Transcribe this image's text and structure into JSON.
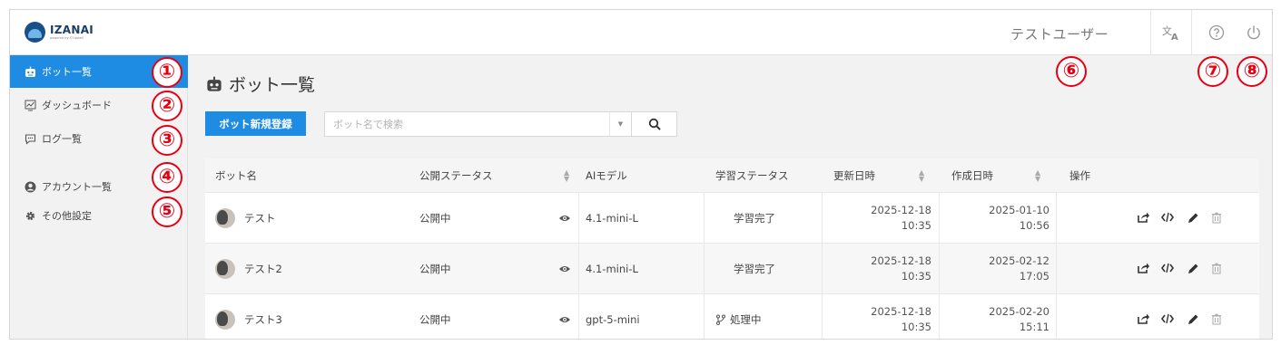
{
  "header": {
    "logo_name": "IZANAI",
    "logo_sub": "powered by ©Upwell",
    "user_name": "テストユーザー"
  },
  "sidebar": {
    "items": [
      {
        "label": "ボット一覧",
        "icon": "robot-icon",
        "active": true
      },
      {
        "label": "ダッシュボード",
        "icon": "chart-icon",
        "active": false
      },
      {
        "label": "ログ一覧",
        "icon": "chat-icon",
        "active": false
      },
      {
        "label": "アカウント一覧",
        "icon": "user-icon",
        "active": false
      },
      {
        "label": "その他設定",
        "icon": "gear-icon",
        "active": false
      }
    ]
  },
  "annotations": [
    "①",
    "②",
    "③",
    "④",
    "⑤",
    "⑥",
    "⑦",
    "⑧"
  ],
  "main": {
    "title": "ボット一覧",
    "new_button": "ボット新規登録",
    "search_placeholder": "ボット名で検索",
    "columns": [
      "ボット名",
      "公開ステータス",
      "AIモデル",
      "学習ステータス",
      "更新日時",
      "作成日時",
      "操作"
    ],
    "rows": [
      {
        "name": "テスト",
        "publish": "公開中",
        "model": "4.1-mini-L",
        "learn": "学習完了",
        "updated_date": "2025-12-18",
        "updated_time": "10:35",
        "created_date": "2025-01-10",
        "created_time": "10:56"
      },
      {
        "name": "テスト2",
        "publish": "公開中",
        "model": "4.1-mini-L",
        "learn": "学習完了",
        "updated_date": "2025-12-18",
        "updated_time": "10:35",
        "created_date": "2025-02-12",
        "created_time": "17:05"
      },
      {
        "name": "テスト3",
        "publish": "公開中",
        "model": "gpt-5-mini",
        "learn": "処理中",
        "updated_date": "2025-12-18",
        "updated_time": "10:35",
        "created_date": "2025-02-20",
        "created_time": "15:11"
      }
    ]
  },
  "colors": {
    "accent": "#1e8ce3",
    "annotation": "#e60012"
  }
}
